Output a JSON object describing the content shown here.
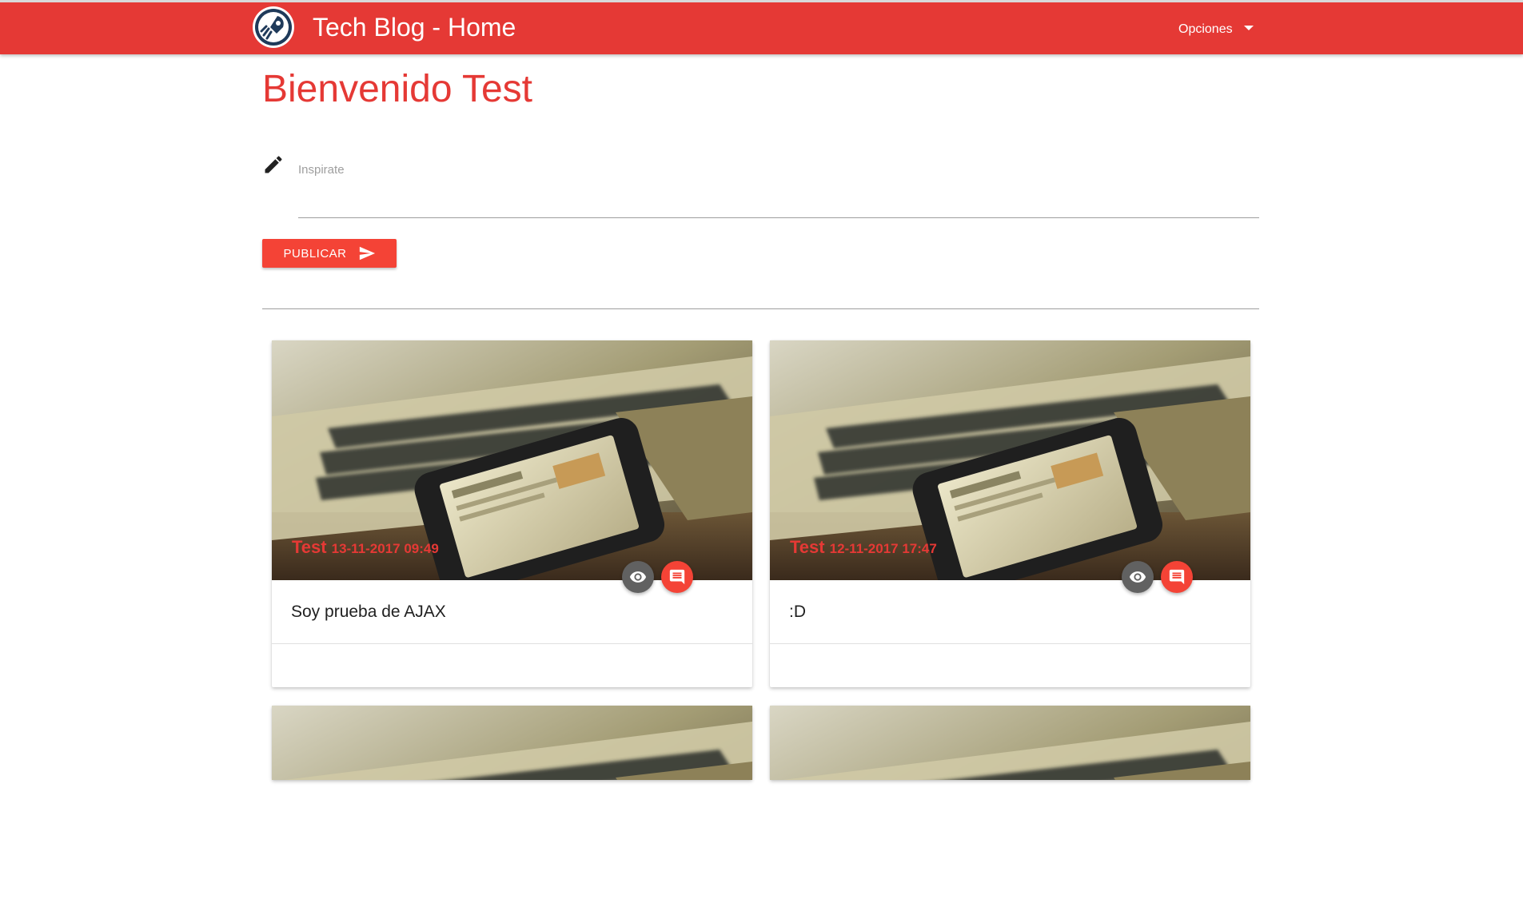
{
  "header": {
    "title": "Tech Blog - Home",
    "options_label": "Opciones",
    "logo_icon": "rocket-logo-icon"
  },
  "welcome": "Bienvenido Test",
  "composer": {
    "label": "Inspirate",
    "value": "",
    "icon": "pencil-icon",
    "publish_label": "PUBLICAR",
    "publish_icon": "send-icon"
  },
  "posts": [
    {
      "author": "Test",
      "date": "13-11-2017 09:49",
      "text": "Soy prueba de AJAX"
    },
    {
      "author": "Test",
      "date": "12-11-2017 17:47",
      "text": ":D"
    },
    {
      "author": "",
      "date": "",
      "text": ""
    },
    {
      "author": "",
      "date": "",
      "text": ""
    }
  ],
  "card_icons": {
    "view": "eye-icon",
    "comment": "comment-icon"
  },
  "colors": {
    "accent": "#e53935",
    "button": "#f44336",
    "fab_view": "#616161"
  }
}
